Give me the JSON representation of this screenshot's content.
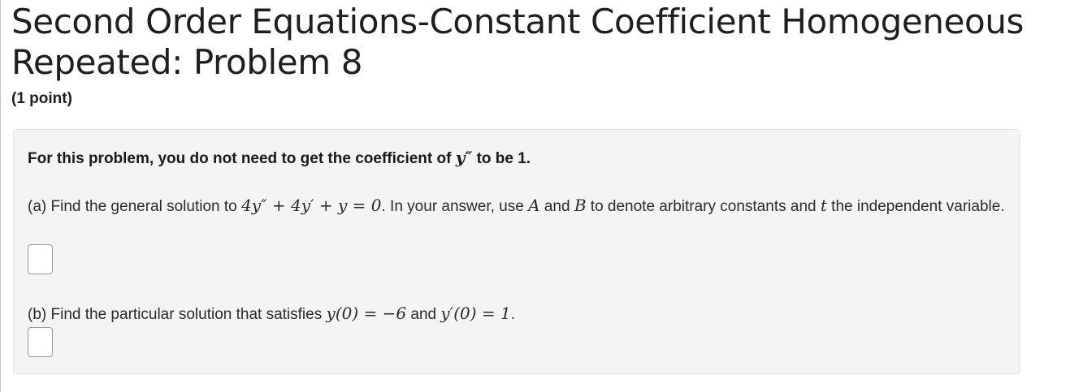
{
  "problem": {
    "title": "Second Order Equations-Constant Coefficient Homogeneous Repeated: Problem 8",
    "title_line1": "Second Order Equations-Constant Coefficient Homogeneous",
    "title_line2": "Repeated: Problem 8",
    "points": "(1 point)"
  },
  "statement": {
    "note_prefix": "For this problem, you do not need to get the coefficient of ",
    "note_math": "y″",
    "note_suffix": " to be 1.",
    "part_a": {
      "label": "(a) Find the general solution to ",
      "equation": "4y″ + 4y′ + y = 0",
      "text_1": ". In your answer, use ",
      "const_a": "A",
      "text_2": " and ",
      "const_b": "B",
      "text_3": " to denote arbitrary constants and ",
      "var_t": "t",
      "text_4": " the independent variable."
    },
    "part_b": {
      "label": "(b) Find the particular solution that satisfies ",
      "cond_1": "y(0) = −6",
      "text_1": " and ",
      "cond_2": "y′(0) = 1",
      "text_2": "."
    }
  },
  "answers": {
    "part_a_value": "",
    "part_b_value": ""
  },
  "colors": {
    "box_background": "#f4f4f4",
    "box_border": "#e2e2e2",
    "text": "#212529"
  }
}
